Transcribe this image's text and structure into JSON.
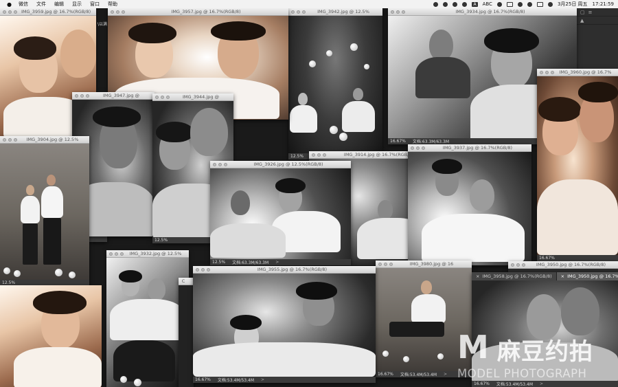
{
  "menubar": {
    "menus": [
      "微信",
      "文件",
      "编辑",
      "显示",
      "窗口",
      "帮助"
    ],
    "ime": "A",
    "ime_label": "ABC",
    "date": "3月25日 周五",
    "time": "17:21:59"
  },
  "windows": {
    "w3959": {
      "title": "IMG_3959.jpg @ 16.7%(RGB/8)"
    },
    "w3957": {
      "title": "IMG_3957.jpg @ 16.7%(RGB/8)"
    },
    "w3942": {
      "title": "IMG_3942.jpg @ 12.5%",
      "zoom": "12.5%"
    },
    "w3934": {
      "title": "IMG_3934.jpg @ 16.7%(RGB/8)",
      "zoom": "16.67%",
      "doc": "文档:63.3M/63.3M"
    },
    "w3960": {
      "title": "IMG_3960.jpg @ 16.7%",
      "zoom": "16.67%"
    },
    "w3947": {
      "title": "IMG_3947.jpg @"
    },
    "w3944": {
      "title": "IMG_3944.jpg @"
    },
    "w3904": {
      "title": "IMG_3904.jpg @ 12.5%",
      "zoom": "12.5%"
    },
    "w3914": {
      "title": "IMG_3914.jpg @ 16.7%(RGB/8)"
    },
    "w3937": {
      "title": "IMG_3937.jpg @ 16.7%(RGB/8)"
    },
    "w3926": {
      "title": "IMG_3926.jpg @ 12.5%(RGB/8)",
      "zoom": "12.5%",
      "doc": "文档:63.3M/63.3M",
      "arrow": ">"
    },
    "w3944z": {
      "zoom": "12.5%"
    },
    "w3932": {
      "title": "IMG_3932.jpg @ 12.5%"
    },
    "w3955": {
      "title": "IMG_3955.jpg @ 16.7%(RGB/8)",
      "zoom": "16.67%",
      "doc": "文档:53.4M/53.4M",
      "arrow": ">"
    },
    "w3980": {
      "title": "IMG_3980.jpg @ 16",
      "zoom": "16.67%",
      "doc": "文档:53.4M/53.4M",
      "arrow": ">"
    },
    "w3950": {
      "title": "IMG_3950.jpg @ 16.7%(RGB/8)"
    }
  },
  "tabbed": {
    "tab1": "IMG_3958.jpg @ 16.7%(RGB/8)",
    "tab2": "IMG_3950.jpg @ 16.7%(RGB/",
    "zoom": "16.67%",
    "doc": "文档:53.4M/53.4M",
    "arrow": ">"
  },
  "partial_labels": {
    "left_snippet": "\\以满",
    "snippet_b": "B(",
    "snippet_c": "C"
  },
  "watermark": {
    "logo": "M",
    "brand_cn": "麻豆约拍",
    "brand_en": "MODEL PHOTOGRAPH"
  }
}
